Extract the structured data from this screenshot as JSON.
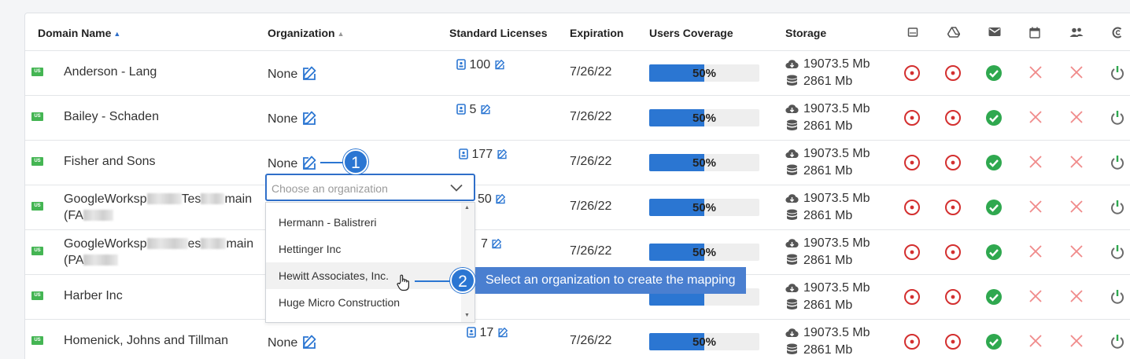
{
  "table": {
    "headers": {
      "domain": "Domain Name",
      "organization": "Organization",
      "licenses": "Standard Licenses",
      "expiration": "Expiration",
      "coverage": "Users Coverage",
      "storage": "Storage"
    },
    "header_icons": [
      "drive-storage-icon",
      "google-drive-icon",
      "mail-icon",
      "calendar-icon",
      "contacts-icon",
      "sites-icon"
    ],
    "rows": [
      {
        "flag": "US",
        "name": "Anderson - Lang",
        "org": "None",
        "licenses": "100",
        "expiration": "7/26/22",
        "coverage": "50%",
        "coverage_fraction": 0.5,
        "cloud": "19073.5 Mb",
        "db": "2861 Mb"
      },
      {
        "flag": "US",
        "name": "Bailey - Schaden",
        "org": "None",
        "licenses": "5",
        "expiration": "7/26/22",
        "coverage": "50%",
        "coverage_fraction": 0.5,
        "cloud": "19073.5 Mb",
        "db": "2861 Mb"
      },
      {
        "flag": "US",
        "name": "Fisher and Sons",
        "org": "None",
        "licenses": "177",
        "expiration": "7/26/22",
        "coverage": "50%",
        "coverage_fraction": 0.5,
        "cloud": "19073.5 Mb",
        "db": "2861 Mb"
      },
      {
        "flag": "US",
        "name_a": "GoogleWorksp",
        "name_b": "Tes",
        "name_c": "main",
        "name_line2": "(FA",
        "org": "",
        "licenses": "50",
        "expiration": "7/26/22",
        "coverage": "50%",
        "coverage_fraction": 0.5,
        "cloud": "19073.5 Mb",
        "db": "2861 Mb"
      },
      {
        "flag": "US",
        "name_a": "GoogleWorksp",
        "name_b": "es",
        "name_c": "main",
        "name_line2": "(PA",
        "org": "",
        "licenses": "7",
        "expiration": "7/26/22",
        "coverage": "50%",
        "coverage_fraction": 0.5,
        "cloud": "19073.5 Mb",
        "db": "2861 Mb"
      },
      {
        "flag": "US",
        "name": "Harber Inc",
        "org": "",
        "licenses": "",
        "expiration": "",
        "coverage": "",
        "coverage_fraction": 0.5,
        "cloud": "19073.5 Mb",
        "db": "2861 Mb"
      },
      {
        "flag": "US",
        "name": "Homenick, Johns and Tillman",
        "org": "None",
        "licenses": "17",
        "expiration": "7/26/22",
        "coverage": "50%",
        "coverage_fraction": 0.5,
        "cloud": "19073.5 Mb",
        "db": "2861 Mb"
      }
    ],
    "status_icons": [
      "disabled-circle-icon",
      "disabled-circle-icon",
      "check-circle-icon",
      "x-icon",
      "x-icon",
      "power-icon"
    ]
  },
  "dropdown": {
    "placeholder": "Choose an organization",
    "options": [
      "Hermann - Balistreri",
      "Hettinger Inc",
      "Hewitt Associates, Inc.",
      "Huge Micro Construction"
    ],
    "highlighted": "Hewitt Associates, Inc."
  },
  "callouts": {
    "step1": "1",
    "step2": "2",
    "tooltip": "Select an organization to create the mapping"
  },
  "colors": {
    "accent": "#2b76d2",
    "flag_green": "#44b553",
    "red": "#d32f2f",
    "green": "#2fa84f",
    "light_red": "#f08a8a"
  }
}
